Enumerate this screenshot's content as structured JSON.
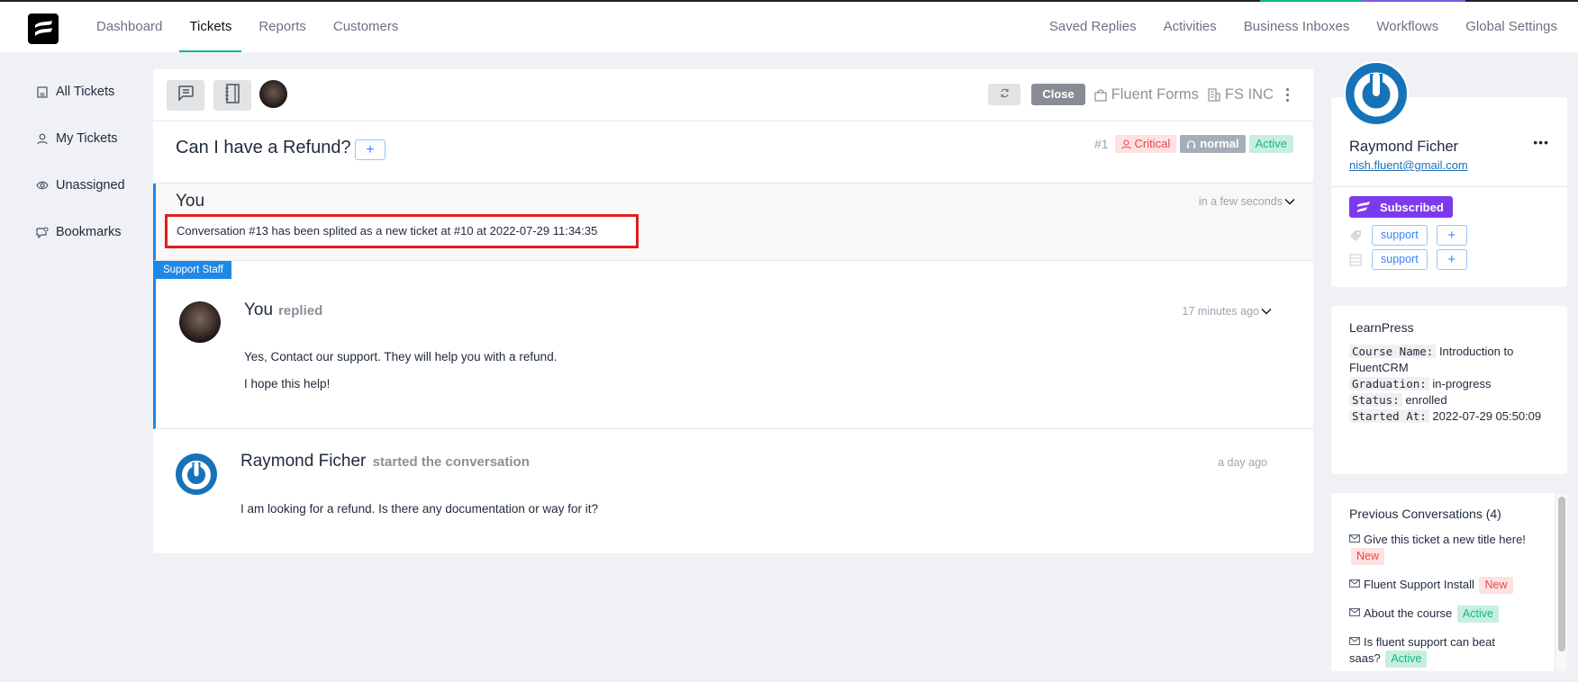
{
  "header": {
    "nav_left": [
      "Dashboard",
      "Tickets",
      "Reports",
      "Customers"
    ],
    "active_nav": "Tickets",
    "nav_right": [
      "Saved Replies",
      "Activities",
      "Business Inboxes",
      "Workflows",
      "Global Settings"
    ],
    "accent_colors": {
      "green": "#10b981",
      "purple": "#7c5ce4"
    }
  },
  "sidebar": {
    "items": [
      {
        "label": "All Tickets",
        "icon": "list-icon"
      },
      {
        "label": "My Tickets",
        "icon": "user-icon"
      },
      {
        "label": "Unassigned",
        "icon": "eye-icon"
      },
      {
        "label": "Bookmarks",
        "icon": "bookmark-chat-icon"
      }
    ]
  },
  "toolbar": {
    "close_label": "Close",
    "product": "Fluent Forms",
    "company": "FS INC"
  },
  "ticket": {
    "title": "Can I have a Refund?",
    "add_label": "+",
    "number": "#1",
    "priority": "Critical",
    "client_priority": "normal",
    "status": "Active"
  },
  "conversation": {
    "note": {
      "author": "You",
      "time": "in a few seconds",
      "text": "Conversation #13 has been splited as a new ticket at #10 at 2022-07-29 11:34:35"
    },
    "reply": {
      "tag": "Support Staff",
      "author": "You",
      "verb": "replied",
      "time": "17 minutes ago",
      "paragraphs": [
        "Yes, Contact our support. They will help you with a refund.",
        "I hope this help!"
      ]
    },
    "start": {
      "author": "Raymond Ficher",
      "verb": "started the conversation",
      "time": "a day ago",
      "text": "I am looking for a refund. Is there any documentation or way for it?"
    }
  },
  "customer": {
    "name": "Raymond Ficher",
    "email": "nish.fluent@gmail.com",
    "more": "•••",
    "subscription": "Subscribed",
    "tags": [
      "support"
    ],
    "lists": [
      "support"
    ],
    "add_label": "+"
  },
  "learnpress": {
    "title": "LearnPress",
    "fields": [
      {
        "key": "Course Name:",
        "value": "Introduction to FluentCRM"
      },
      {
        "key": "Graduation:",
        "value": "in-progress"
      },
      {
        "key": "Status:",
        "value": "enrolled"
      },
      {
        "key": "Started At:",
        "value": "2022-07-29 05:50:09"
      }
    ]
  },
  "previous": {
    "title": "Previous Conversations (4)",
    "items": [
      {
        "title": "Give this ticket a new title here!",
        "status": "New"
      },
      {
        "title": "Fluent Support Install",
        "status": "New"
      },
      {
        "title": "About the course",
        "status": "Active"
      },
      {
        "title": "Is fluent support can beat saas?",
        "status": "Active"
      }
    ]
  }
}
